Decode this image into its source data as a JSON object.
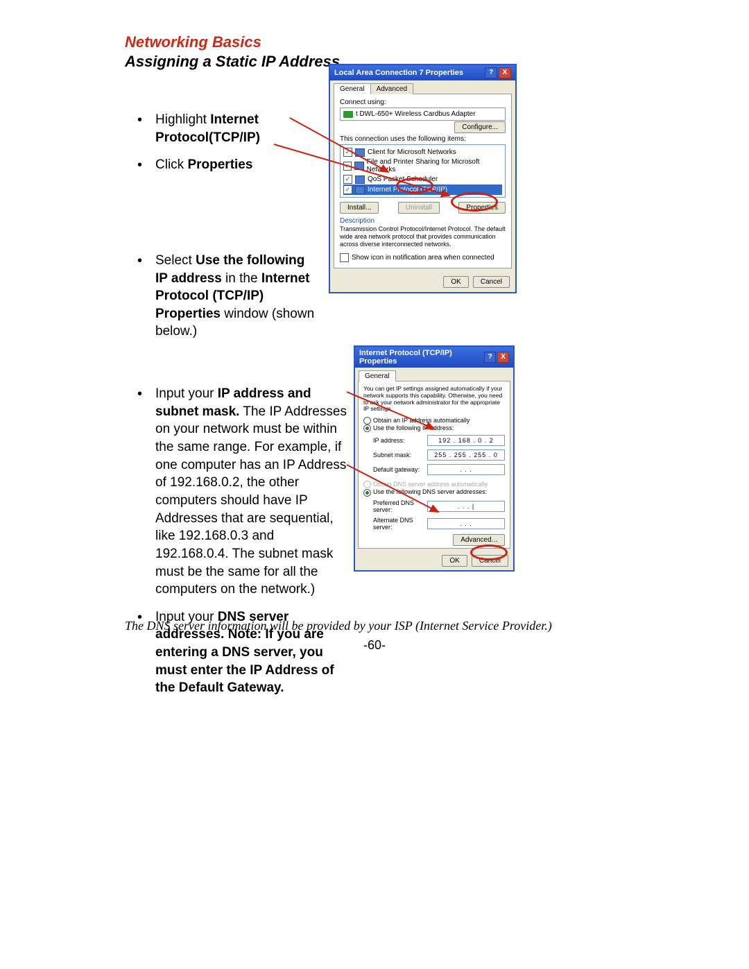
{
  "heading": {
    "line1": "Networking Basics",
    "line2": "Assigning a Static IP Address"
  },
  "instructions": {
    "b1_a": "Highlight ",
    "b1_b": "Internet Protocol(TCP/IP)",
    "b2_a": "Click ",
    "b2_b": "Properties",
    "b3_a": "Select ",
    "b3_b": "Use the following IP address",
    "b3_c": " in the ",
    "b3_d": "Internet Protocol (TCP/IP) Properties",
    "b3_e": " window (shown below.)",
    "b4_a": "Input your ",
    "b4_b": "IP address and subnet mask.",
    "b4_c": " The IP Addresses on your network must be within the same range. For example, if one computer has an IP Address of 192.168.0.2, the other computers should have IP Addresses that are sequential, like 192.168.0.3 and 192.168.0.4. The subnet mask must be the same for all the computers on the network.)",
    "b5_a": "Input your ",
    "b5_b": "DNS server addresses.   Note:   If you are entering a DNS server, you must enter the IP Address of the Default Gateway."
  },
  "footnote": "The DNS server information will be provided by your ISP (Internet Service Provider.)",
  "pageNumber": "-60-",
  "dialog1": {
    "title": "Local Area Connection 7 Properties",
    "tab_general": "General",
    "tab_advanced": "Advanced",
    "lbl_connect_using": "Connect using:",
    "device": "t DWL-650+ Wireless Cardbus Adapter",
    "btn_configure": "Configure...",
    "lbl_conn_uses": "This connection uses the following items:",
    "items": [
      "Client for Microsoft Networks",
      "File and Printer Sharing for Microsoft Networks",
      "QoS Packet Scheduler",
      "Internet Protocol (TCP/IP)"
    ],
    "btn_install": "Install...",
    "btn_uninstall": "Uninstall",
    "btn_properties": "Properties",
    "lbl_description": "Description",
    "description": "Transmission Control Protocol/Internet Protocol. The default wide area network protocol that provides communication across diverse interconnected networks.",
    "lbl_show_icon": "Show icon in notification area when connected",
    "btn_ok": "OK",
    "btn_cancel": "Cancel"
  },
  "dialog2": {
    "title": "Internet Protocol (TCP/IP) Properties",
    "tab_general": "General",
    "intro": "You can get IP settings assigned automatically if your network supports this capability. Otherwise, you need to ask your network administrator for the appropriate IP settings.",
    "r_obtain_ip": "Obtain an IP address automatically",
    "r_use_ip": "Use the following IP address:",
    "lbl_ip": "IP address:",
    "val_ip": "192 . 168 .  0  .  2",
    "lbl_subnet": "Subnet mask:",
    "val_subnet": "255 . 255 . 255 .  0",
    "lbl_gateway": "Default gateway:",
    "val_gateway": ".       .       .",
    "r_obtain_dns": "Obtain DNS server address automatically",
    "r_use_dns": "Use the following DNS server addresses:",
    "lbl_pref_dns": "Preferred DNS server:",
    "val_pref_dns": ".       .       .   |",
    "lbl_alt_dns": "Alternate DNS server:",
    "val_alt_dns": ".       .       .",
    "btn_advanced": "Advanced...",
    "btn_ok": "OK",
    "btn_cancel": "Cancel"
  }
}
